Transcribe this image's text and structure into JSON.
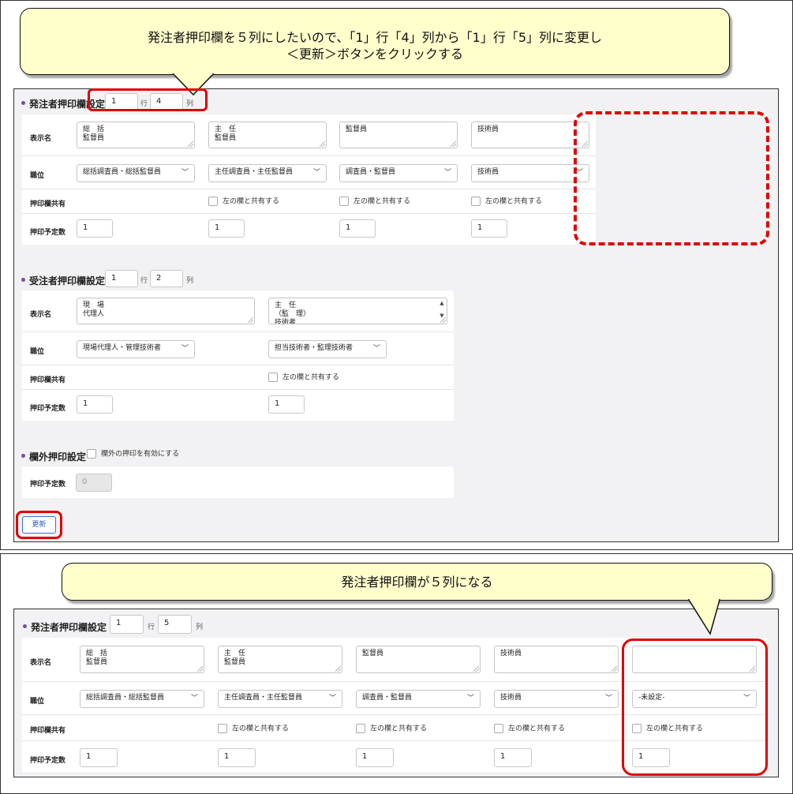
{
  "callout_top": {
    "line1": "発注者押印欄を５列にしたいので、「1」行「4」列から「1」行「5」列に変更し",
    "line2": "＜更新＞ボタンをクリックする"
  },
  "callout_bottom": {
    "text": "発注者押印欄が５列になる"
  },
  "row_labels": {
    "display_name": "表示名",
    "position": "職位",
    "share": "押印欄共有",
    "planned": "押印予定数"
  },
  "unit_labels": {
    "row": "行",
    "col": "列"
  },
  "share_label": "左の欄と共有する",
  "orderer_before": {
    "title": "発注者押印欄設定",
    "rows": "1",
    "cols": "4",
    "columns": [
      {
        "name": "総　括\n監督員",
        "position": "総括調査員・総括監督員",
        "planned": "1"
      },
      {
        "name": "主　任\n監督員",
        "position": "主任調査員・主任監督員",
        "planned": "1"
      },
      {
        "name": "監督員",
        "position": "調査員・監督員",
        "planned": "1"
      },
      {
        "name": "技術員",
        "position": "技術員",
        "planned": "1"
      }
    ]
  },
  "contractor": {
    "title": "受注者押印欄設定",
    "rows": "1",
    "cols": "2",
    "columns": [
      {
        "name": "現　場\n代理人",
        "position": "現場代理人・管理技術者",
        "planned": "1"
      },
      {
        "name": "主　任\n（監　理）\n技術者",
        "position": "担当技術者・監理技術者",
        "planned": "1"
      }
    ]
  },
  "outside": {
    "title": "欄外押印設定",
    "checkbox_label": "欄外の押印を有効にする",
    "planned": "0"
  },
  "update_button": "更新",
  "orderer_after": {
    "title": "発注者押印欄設定",
    "rows": "1",
    "cols": "5",
    "columns": [
      {
        "name": "総　括\n監督員",
        "position": "総括調査員・総括監督員",
        "planned": "1"
      },
      {
        "name": "主　任\n監督員",
        "position": "主任調査員・主任監督員",
        "planned": "1"
      },
      {
        "name": "監督員",
        "position": "調査員・監督員",
        "planned": "1"
      },
      {
        "name": "技術員",
        "position": "技術員",
        "planned": "1"
      },
      {
        "name": "",
        "position": "-未設定-",
        "planned": "1"
      }
    ]
  },
  "colors": {
    "highlight_red": "#e00000",
    "callout_bg": "#ffffcc",
    "button_blue": "#2a5bc8"
  }
}
